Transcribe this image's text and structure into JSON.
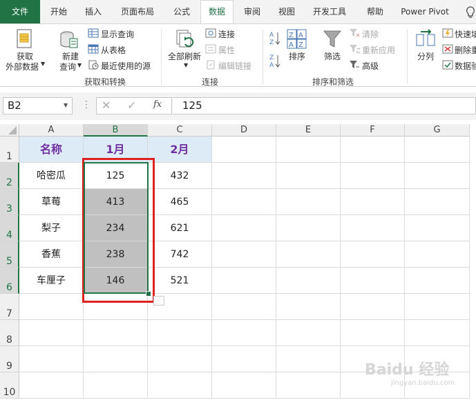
{
  "ribbon": {
    "tabs": [
      "文件",
      "开始",
      "插入",
      "页面布局",
      "公式",
      "数据",
      "审阅",
      "视图",
      "开发工具",
      "帮助",
      "Power Pivot"
    ],
    "active_tab": "数据",
    "groups": {
      "get_transform": {
        "label": "获取和转换",
        "get_data_line1": "获取",
        "get_data_line2": "外部数据",
        "new_query_line1": "新建",
        "new_query_line2": "查询",
        "show_queries": "显示查询",
        "from_table": "从表格",
        "recent_sources": "最近使用的源"
      },
      "connections": {
        "label": "连接",
        "refresh_all": "全部刷新",
        "connections": "连接",
        "properties": "属性",
        "edit_links": "编辑链接"
      },
      "sort_filter": {
        "label": "排序和筛选",
        "sort": "排序",
        "filter": "筛选",
        "clear": "清除",
        "reapply": "重新应用",
        "advanced": "高级"
      },
      "data_tools": {
        "text_to_columns": "分列",
        "flash_fill": "快速填",
        "remove_duplicates": "删除重",
        "data_validation": "数据验"
      }
    }
  },
  "formula_bar": {
    "name_box": "B2",
    "fx": "fx",
    "value": "125"
  },
  "grid": {
    "columns": [
      "A",
      "B",
      "C",
      "D",
      "E",
      "F",
      "G"
    ],
    "selected_column": "B",
    "rows": [
      "1",
      "2",
      "3",
      "4",
      "5",
      "6",
      "7",
      "8",
      "9",
      "10"
    ],
    "header_row": [
      "名称",
      "1月",
      "2月"
    ],
    "data": [
      [
        "哈密瓜",
        "125",
        "432"
      ],
      [
        "草莓",
        "413",
        "465"
      ],
      [
        "梨子",
        "234",
        "621"
      ],
      [
        "香蕉",
        "238",
        "742"
      ],
      [
        "车厘子",
        "146",
        "521"
      ]
    ]
  },
  "colors": {
    "accent": "#217346",
    "header_fill": "#ddebf7",
    "header_text": "#7030a0",
    "selection_fill": "#c0c0c0",
    "highlight_box": "#e02020"
  }
}
